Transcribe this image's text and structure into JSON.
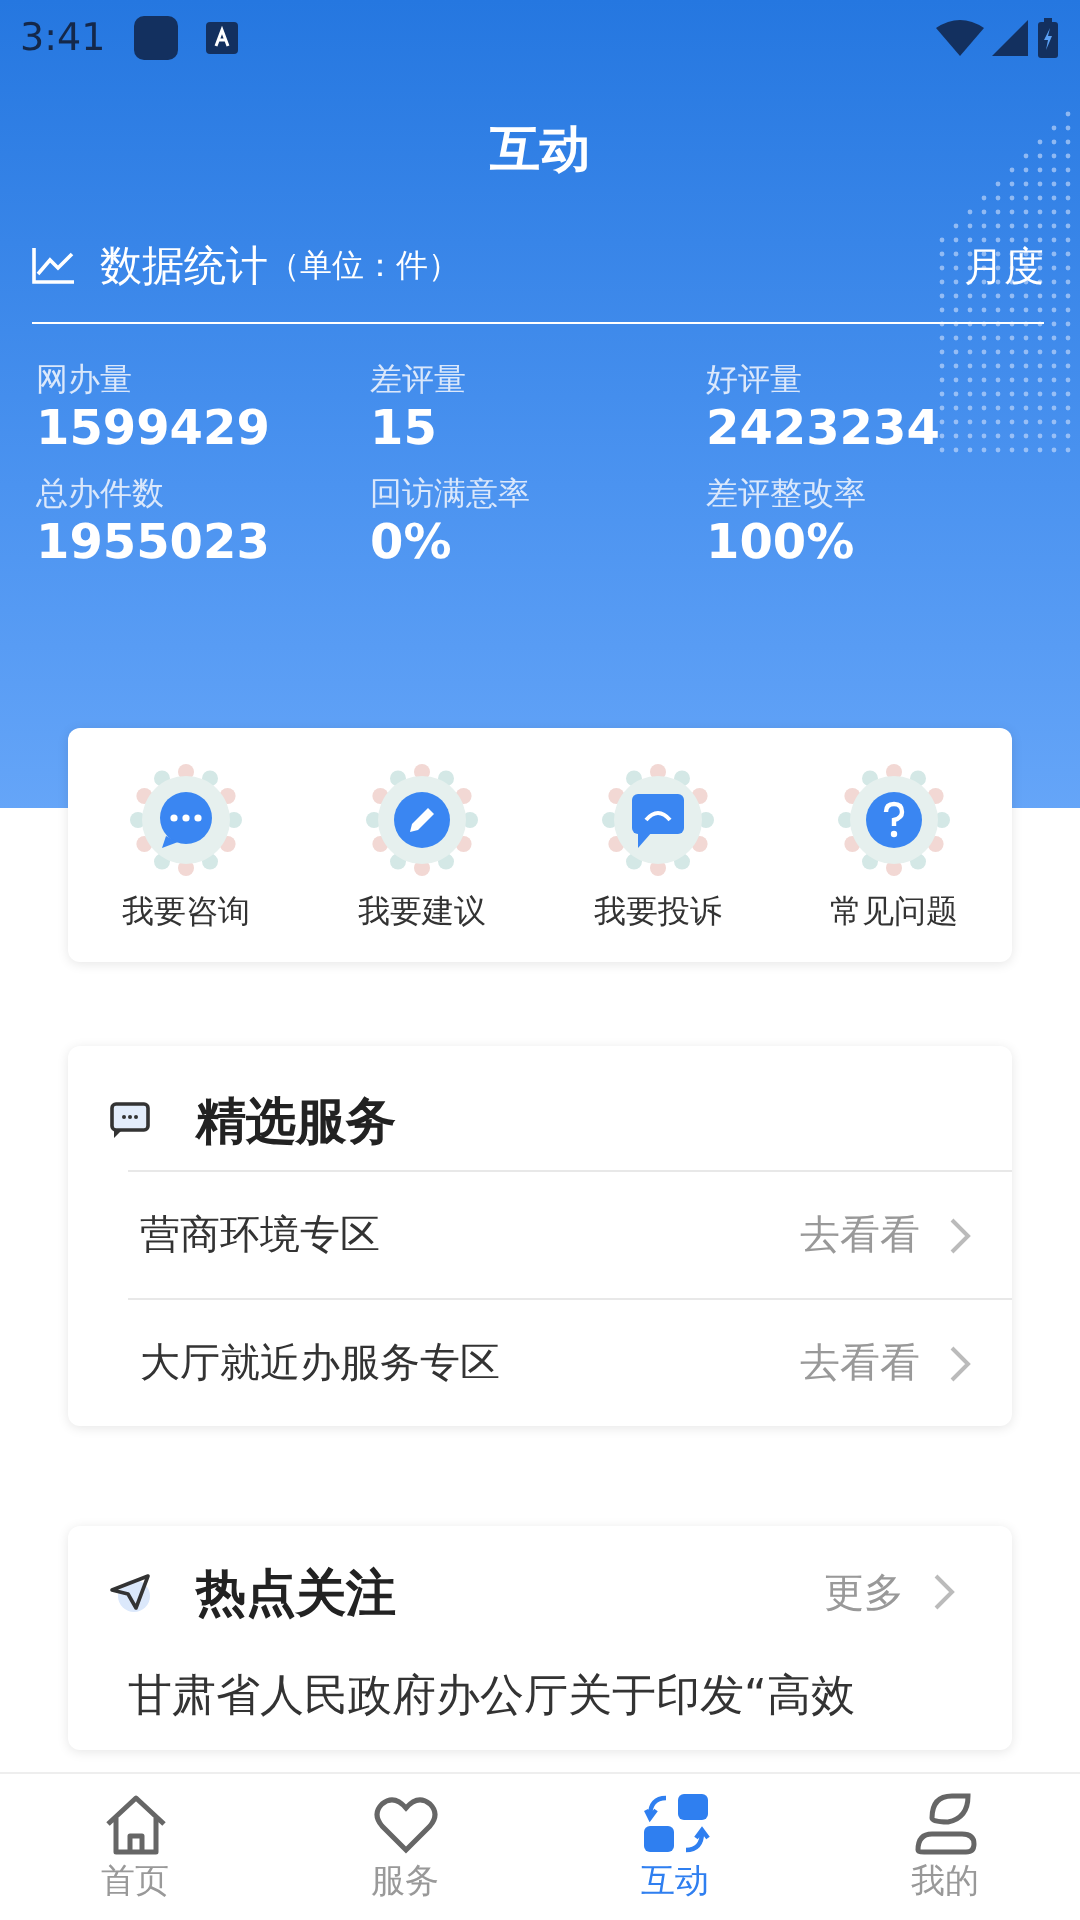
{
  "status_bar": {
    "time": "3:41"
  },
  "title": "互动",
  "stats": {
    "title": "数据统计",
    "unit": "（单位：件）",
    "period": "月度",
    "items": [
      {
        "label": "网办量",
        "value": "1599429"
      },
      {
        "label": "差评量",
        "value": "15"
      },
      {
        "label": "好评量",
        "value": "2423234"
      },
      {
        "label": "总办件数",
        "value": "1955023"
      },
      {
        "label": "回访满意率",
        "value": "0%"
      },
      {
        "label": "差评整改率",
        "value": "100%"
      }
    ]
  },
  "quick_actions": [
    {
      "label": "我要咨询"
    },
    {
      "label": "我要建议"
    },
    {
      "label": "我要投诉"
    },
    {
      "label": "常见问题"
    }
  ],
  "featured": {
    "title": "精选服务",
    "items": [
      {
        "label": "营商环境专区",
        "action": "去看看"
      },
      {
        "label": "大厅就近办服务专区",
        "action": "去看看"
      }
    ]
  },
  "hot": {
    "title": "热点关注",
    "more": "更多",
    "items": [
      {
        "text": "甘肃省人民政府办公厅关于印发“高效"
      }
    ]
  },
  "tabs": [
    {
      "label": "首页",
      "selected": false
    },
    {
      "label": "服务",
      "selected": false
    },
    {
      "label": "互动",
      "selected": true
    },
    {
      "label": "我的",
      "selected": false
    }
  ]
}
